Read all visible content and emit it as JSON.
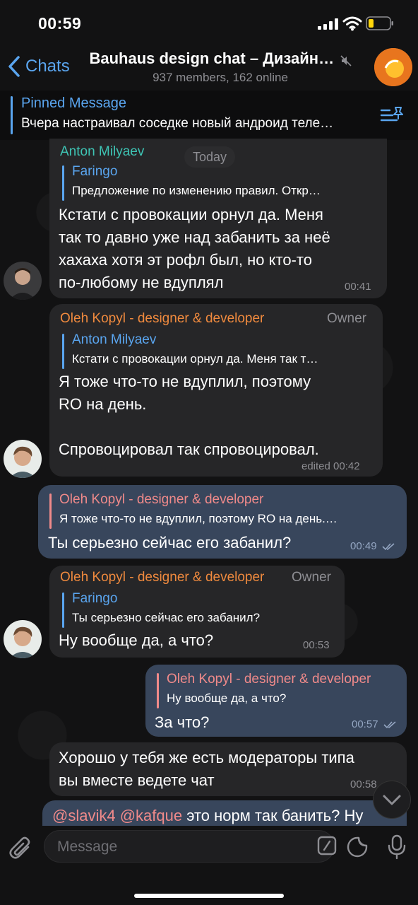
{
  "status": {
    "time": "00:59"
  },
  "header": {
    "back_label": "Chats",
    "title": "Bauhaus design chat – Дизайн…",
    "subtitle": "937 members, 162 online"
  },
  "pinned": {
    "title": "Pinned Message",
    "text": "Вчера настраивал соседке новый андроид теле…"
  },
  "day_label": "Today",
  "messages": [
    {
      "sender": "Anton Milyaev",
      "reply_name": "Faringo",
      "reply_text": "Предложение по изменению правил. Откр…",
      "text": "Кстати с провокации орнул да. Меня\nтак то давно уже над забанить за неё\nхахаха хотя эт рофл был, но кто-то\nпо-любому не вдуплял",
      "time": "00:41"
    },
    {
      "sender": "Oleh Kopyl - designer & developer",
      "role": "Owner",
      "reply_name": "Anton Milyaev",
      "reply_text": "Кстати с провокации орнул да. Меня так т…",
      "text": "Я тоже что-то не вдуплил, поэтому\nRO на день.\n\nСпровоцировал так спровоцировал.",
      "time": "edited 00:42"
    },
    {
      "reply_name": "Oleh Kopyl - designer & developer",
      "reply_text": "Я тоже что-то не вдуплил, поэтому RO на день.…",
      "text": "Ты серьезно сейчас его забанил?",
      "time": "00:49"
    },
    {
      "sender": "Oleh Kopyl - designer & developer",
      "role": "Owner",
      "reply_name": "Faringo",
      "reply_text": "Ты серьезно сейчас его забанил?",
      "text": "Ну вообще да, а что?",
      "time": "00:53"
    },
    {
      "reply_name": "Oleh Kopyl - designer & developer",
      "reply_text": "Ну вообще да, а что?",
      "text": "За что?",
      "time": "00:57"
    },
    {
      "text": "Хорошо у тебя же есть модераторы типа\nвы вместе ведете чат",
      "time": "00:58"
    },
    {
      "mention1": "@slavik4",
      "mention2": "@kafque",
      "text": "это норм так банить? Ну"
    }
  ],
  "input": {
    "placeholder": "Message"
  },
  "colors": {
    "accent": "#5aa5ef",
    "anton": "#3ec4b4",
    "oleh": "#f08a3e",
    "reply_out": "#f08a8a",
    "bubble_in": "#262628",
    "bubble_out": "#38465c"
  }
}
